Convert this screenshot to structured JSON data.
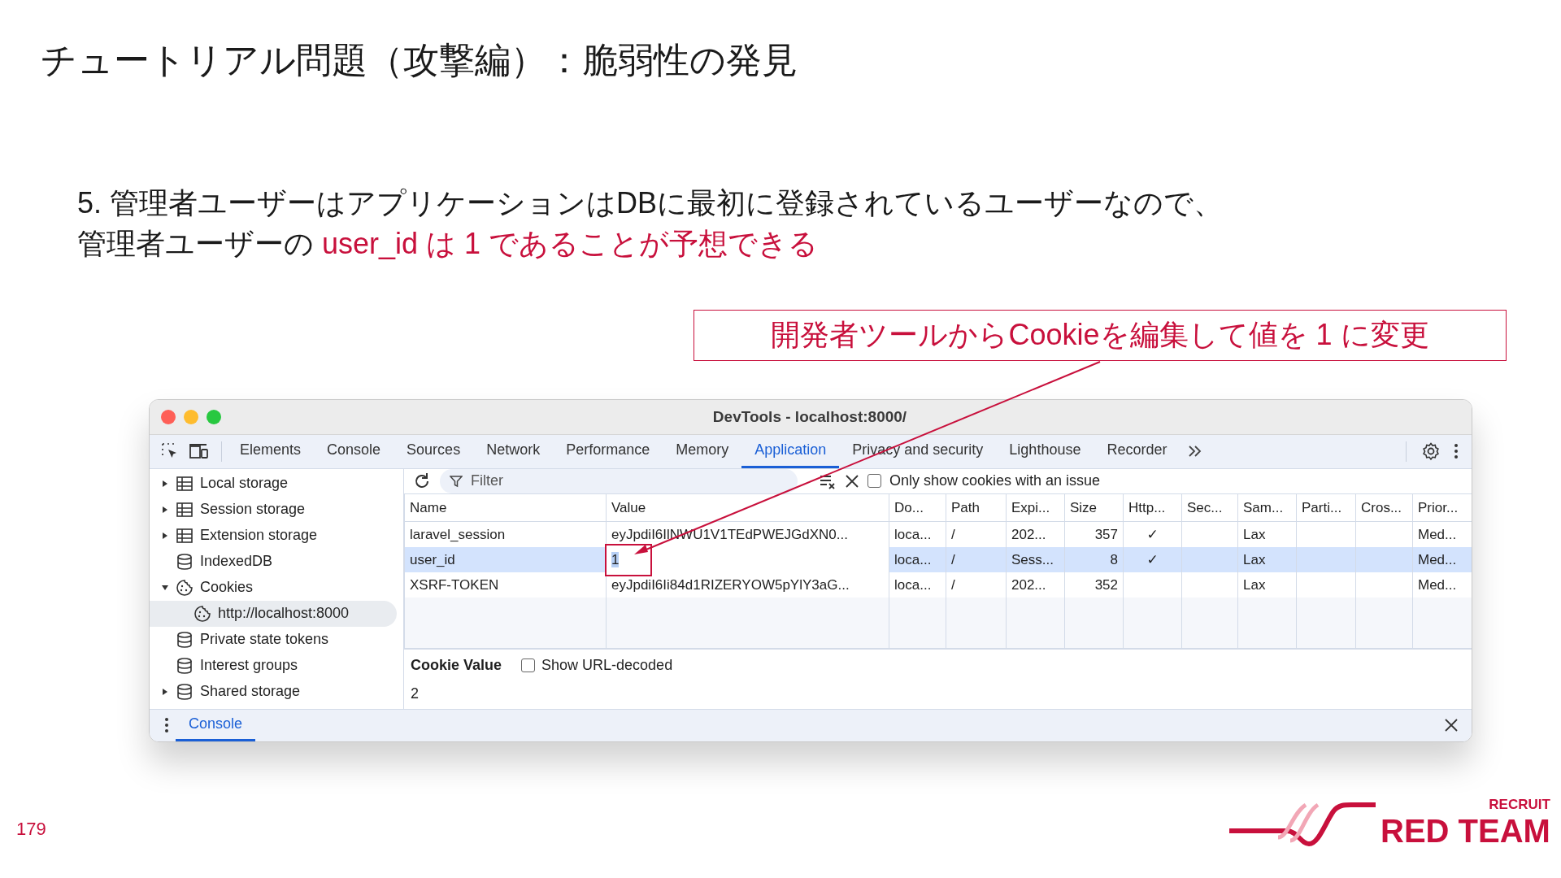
{
  "slide": {
    "title": "チュートリアル問題（攻撃編）：脆弱性の発見",
    "instruction": [
      [
        {
          "text": "5. 管理者ユーザーはアプリケーションはDBに最初に登録されているユーザーなので、",
          "emphasis": false
        }
      ],
      [
        {
          "text": "管理者ユーザーの ",
          "emphasis": false
        },
        {
          "text": "user_id は 1 であることが予想できる",
          "emphasis": true
        }
      ]
    ],
    "callout": "開発者ツールからCookieを編集して値を 1 に変更",
    "page_number": "179",
    "logo": {
      "small": "RECRUIT",
      "large": "RED TEAM"
    }
  },
  "devtools": {
    "window_title": "DevTools - localhost:8000/",
    "tabs": [
      {
        "label": "Elements",
        "selected": false
      },
      {
        "label": "Console",
        "selected": false
      },
      {
        "label": "Sources",
        "selected": false
      },
      {
        "label": "Network",
        "selected": false
      },
      {
        "label": "Performance",
        "selected": false
      },
      {
        "label": "Memory",
        "selected": false
      },
      {
        "label": "Application",
        "selected": true
      },
      {
        "label": "Privacy and security",
        "selected": false
      },
      {
        "label": "Lighthouse",
        "selected": false
      },
      {
        "label": "Recorder",
        "selected": false
      }
    ],
    "sidebar": [
      {
        "label": "Local storage",
        "kind": "table",
        "expanded": false,
        "selected": false
      },
      {
        "label": "Session storage",
        "kind": "table",
        "expanded": false,
        "selected": false
      },
      {
        "label": "Extension storage",
        "kind": "table",
        "expanded": false,
        "selected": false
      },
      {
        "label": "IndexedDB",
        "kind": "database",
        "selected": false
      },
      {
        "label": "Cookies",
        "kind": "cookie",
        "expanded": true,
        "selected": false,
        "children": [
          {
            "label": "http://localhost:8000",
            "kind": "cookie",
            "selected": true
          }
        ]
      },
      {
        "label": "Private state tokens",
        "kind": "database",
        "selected": false
      },
      {
        "label": "Interest groups",
        "kind": "database",
        "selected": false
      },
      {
        "label": "Shared storage",
        "kind": "database",
        "expanded": false,
        "selected": false
      }
    ],
    "filter": {
      "placeholder": "Filter"
    },
    "issue_filter": {
      "label": "Only show cookies with an issue",
      "checked": false
    },
    "table": {
      "columns": [
        {
          "label": "Name",
          "kind": "text"
        },
        {
          "label": "Value",
          "kind": "text"
        },
        {
          "label": "Do...",
          "kind": "text"
        },
        {
          "label": "Path",
          "kind": "text"
        },
        {
          "label": "Expi...",
          "kind": "text"
        },
        {
          "label": "Size",
          "kind": "number"
        },
        {
          "label": "Http...",
          "kind": "flag"
        },
        {
          "label": "Sec...",
          "kind": "flag"
        },
        {
          "label": "Sam...",
          "kind": "text"
        },
        {
          "label": "Parti...",
          "kind": "text"
        },
        {
          "label": "Cros...",
          "kind": "text"
        },
        {
          "label": "Prior...",
          "kind": "text"
        }
      ],
      "rows": [
        {
          "selected": false,
          "editing": false,
          "cells": [
            "laravel_session",
            "eyJpdiI6IlNWU1V1TEdPWEJGdXN0...",
            "loca...",
            "/",
            "202...",
            "357",
            "✓",
            "",
            "Lax",
            "",
            "",
            "Med..."
          ]
        },
        {
          "selected": true,
          "editing": true,
          "cells": [
            "user_id",
            "1",
            "loca...",
            "/",
            "Sess...",
            "8",
            "✓",
            "",
            "Lax",
            "",
            "",
            "Med..."
          ]
        },
        {
          "selected": false,
          "editing": false,
          "cells": [
            "XSRF-TOKEN",
            "eyJpdiI6Ii84d1RIZERYOW5pYlY3aG...",
            "loca...",
            "/",
            "202...",
            "352",
            "",
            "",
            "Lax",
            "",
            "",
            "Med..."
          ]
        }
      ]
    },
    "cookie_value": {
      "label": "Cookie Value",
      "decode": {
        "label": "Show URL-decoded",
        "checked": false
      },
      "value": "2"
    },
    "drawer": {
      "tabs": [
        {
          "label": "Console",
          "selected": true
        }
      ]
    }
  }
}
